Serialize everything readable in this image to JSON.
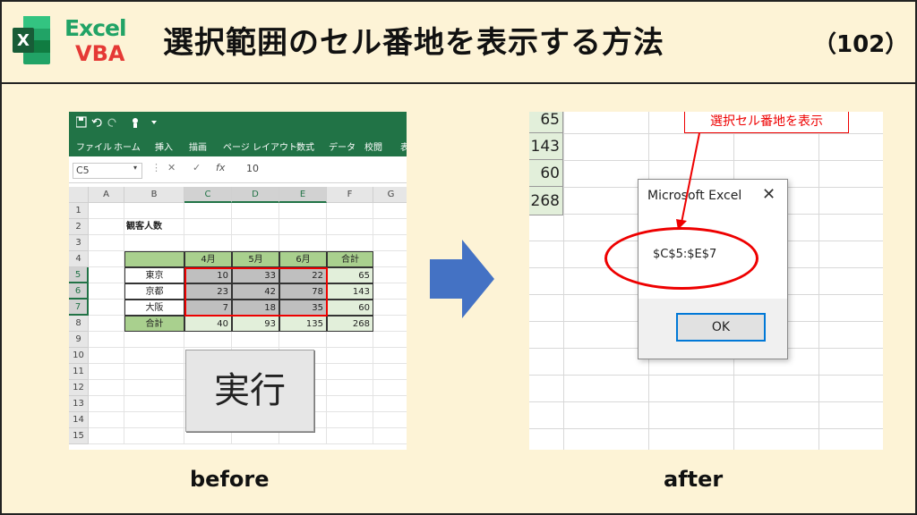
{
  "header": {
    "logo_excel": "Excel",
    "logo_vba": "VBA",
    "title": "選択範囲のセル番地を表示する方法",
    "number": "（102）"
  },
  "before": {
    "ribbon_tabs": [
      "ファイル",
      "ホーム",
      "挿入",
      "描画",
      "ページ レイアウト",
      "数式",
      "データ",
      "校閲",
      "表"
    ],
    "name_box": "C5",
    "formula": "10",
    "columns": [
      "A",
      "B",
      "C",
      "D",
      "E",
      "F",
      "G"
    ],
    "rows": [
      "1",
      "2",
      "3",
      "4",
      "5",
      "6",
      "7",
      "8",
      "9",
      "10",
      "11",
      "12",
      "13",
      "14",
      "15"
    ],
    "table_title": "観客人数",
    "headers": [
      "4月",
      "5月",
      "6月",
      "合計"
    ],
    "data_rows": [
      {
        "city": "東京",
        "values": [
          "10",
          "33",
          "22",
          "65"
        ]
      },
      {
        "city": "京都",
        "values": [
          "23",
          "42",
          "78",
          "143"
        ]
      },
      {
        "city": "大阪",
        "values": [
          "7",
          "18",
          "35",
          "60"
        ]
      }
    ],
    "total_row": {
      "label": "合計",
      "values": [
        "40",
        "93",
        "135",
        "268"
      ]
    },
    "run_button": "実行",
    "caption": "before"
  },
  "after": {
    "column_values": [
      "65",
      "143",
      "60",
      "268"
    ],
    "callout": "選択セル番地を表示",
    "dialog_title": "Microsoft Excel",
    "dialog_close": "✕",
    "dialog_message": "$C$5:$E$7",
    "ok_button": "OK",
    "caption": "after"
  },
  "colors": {
    "excel_green": "#217346",
    "header_green": "#a9d08e",
    "light_green": "#e2efda",
    "highlight_red": "#ee0000",
    "arrow_blue": "#4472c4",
    "background": "#fdf3d6"
  }
}
